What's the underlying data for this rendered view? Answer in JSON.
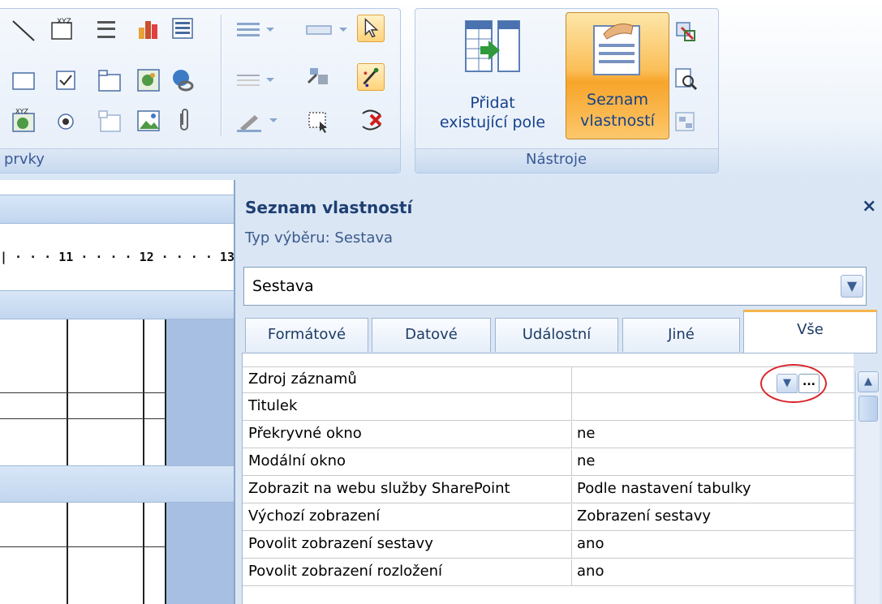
{
  "ribbon": {
    "groups": {
      "prvky": "prvky",
      "nastroje": "Nástroje"
    },
    "buttons": {
      "pridat_line1": "Přidat",
      "pridat_line2": "existující pole",
      "seznam_line1": "Seznam",
      "seznam_line2": "vlastností"
    },
    "control_icons": [
      "line-icon",
      "label-icon",
      "page-break-icon",
      "chart-icon",
      "list-box-icon",
      "rectangle-icon",
      "check-box-icon",
      "tab-control-icon",
      "unbound-object-frame-icon",
      "hyperlink-icon",
      "bound-object-frame-icon",
      "option-button-icon",
      "subform-icon",
      "image-icon",
      "attachment-icon"
    ],
    "format_icons": [
      "line-thickness-icon",
      "line-type-icon",
      "line-color-icon",
      "list-box-icon",
      "insert-control-icon",
      "select-all-icon"
    ],
    "accent": "#f7a52b"
  },
  "left_pane": {
    "ruler_text": "| · · · 11 · · · · 12 · · · · 13 ·"
  },
  "property_sheet": {
    "title": "Seznam vlastností",
    "close_label": "×",
    "selection_type_label": "Typ výběru:",
    "selection_type_value": "Sestava",
    "object_combo_value": "Sestava",
    "tabs": [
      {
        "label": "Formátové",
        "active": false
      },
      {
        "label": "Datové",
        "active": false
      },
      {
        "label": "Událostní",
        "active": false
      },
      {
        "label": "Jiné",
        "active": false
      },
      {
        "label": "Vše",
        "active": true
      }
    ],
    "rows": [
      {
        "name": "Zdroj záznamů",
        "value": ""
      },
      {
        "name": "Titulek",
        "value": ""
      },
      {
        "name": "Překryvné okno",
        "value": "ne"
      },
      {
        "name": "Modální okno",
        "value": "ne"
      },
      {
        "name": "Zobrazit na webu služby SharePoint",
        "value": "Podle nastavení tabulky"
      },
      {
        "name": "Výchozí zobrazení",
        "value": "Zobrazení sestavy"
      },
      {
        "name": "Povolit zobrazení sestavy",
        "value": "ano"
      },
      {
        "name": "Povolit zobrazení rozložení",
        "value": "ano"
      }
    ],
    "dropdown_glyph": "▼",
    "build_glyph": "...",
    "scroll_up_glyph": "▲"
  }
}
